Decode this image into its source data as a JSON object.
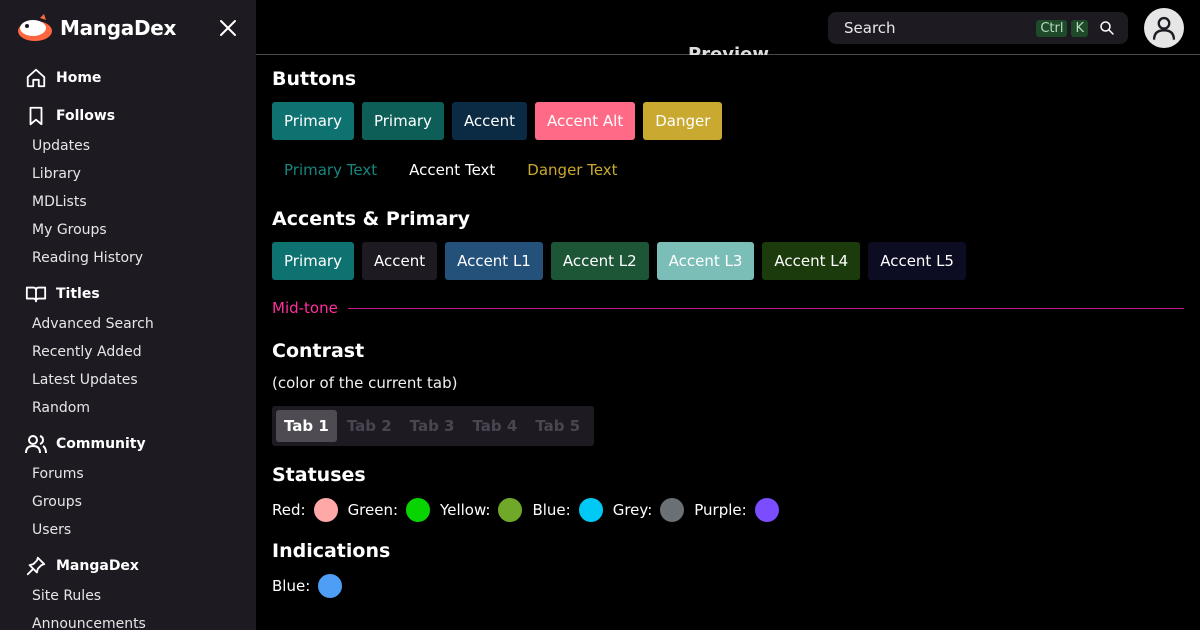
{
  "sidebar": {
    "brand": "MangaDex",
    "sections": [
      {
        "label": "Home",
        "icon": "home-icon",
        "items": []
      },
      {
        "label": "Follows",
        "icon": "bookmark-icon",
        "items": [
          "Updates",
          "Library",
          "MDLists",
          "My Groups",
          "Reading History"
        ]
      },
      {
        "label": "Titles",
        "icon": "book-open-icon",
        "items": [
          "Advanced Search",
          "Recently Added",
          "Latest Updates",
          "Random"
        ]
      },
      {
        "label": "Community",
        "icon": "users-icon",
        "items": [
          "Forums",
          "Groups",
          "Users"
        ]
      },
      {
        "label": "MangaDex",
        "icon": "pin-icon",
        "items": [
          "Site Rules",
          "Announcements"
        ]
      }
    ]
  },
  "header": {
    "search_placeholder": "Search",
    "shortcut_ctrl": "Ctrl",
    "shortcut_key": "K",
    "preview_label": "Preview"
  },
  "main": {
    "buttons_heading": "Buttons",
    "buttons": [
      {
        "label": "Primary",
        "bg": "#0d7270",
        "fg": "#ffffff"
      },
      {
        "label": "Primary",
        "bg": "#0e5e58",
        "fg": "#ffffff"
      },
      {
        "label": "Accent",
        "bg": "#0b2b44",
        "fg": "#ffffff"
      },
      {
        "label": "Accent Alt",
        "bg": "#ff6a87",
        "fg": "#ffffff"
      },
      {
        "label": "Danger",
        "bg": "#c9a92f",
        "fg": "#ffffff"
      }
    ],
    "text_buttons": [
      {
        "label": "Primary Text",
        "color": "#17867e"
      },
      {
        "label": "Accent Text",
        "color": "#ffffff"
      },
      {
        "label": "Danger Text",
        "color": "#c9a92f"
      }
    ],
    "accents_heading": "Accents & Primary",
    "accents": [
      {
        "label": "Primary",
        "bg": "#0d7270",
        "fg": "#ffffff"
      },
      {
        "label": "Accent",
        "bg": "#1e1a22",
        "fg": "#ffffff"
      },
      {
        "label": "Accent L1",
        "bg": "#24517a",
        "fg": "#ffffff"
      },
      {
        "label": "Accent L2",
        "bg": "#1d5537",
        "fg": "#ffffff"
      },
      {
        "label": "Accent L3",
        "bg": "#7bbeb7",
        "fg": "#ffffff"
      },
      {
        "label": "Accent L4",
        "bg": "#1b3b0c",
        "fg": "#ffffff"
      },
      {
        "label": "Accent L5",
        "bg": "#0c0c22",
        "fg": "#ffffff"
      }
    ],
    "midtone_label": "Mid-tone",
    "contrast_heading": "Contrast",
    "contrast_sub": "(color of the current tab)",
    "tabs": [
      {
        "label": "Tab 1",
        "active": true
      },
      {
        "label": "Tab 2",
        "active": false
      },
      {
        "label": "Tab 3",
        "active": false
      },
      {
        "label": "Tab 4",
        "active": false
      },
      {
        "label": "Tab 5",
        "active": false
      }
    ],
    "statuses_heading": "Statuses",
    "statuses": [
      {
        "label": "Red:",
        "color": "#ffa8a8"
      },
      {
        "label": "Green:",
        "color": "#07d400"
      },
      {
        "label": "Yellow:",
        "color": "#70a829"
      },
      {
        "label": "Blue:",
        "color": "#00c9f5"
      },
      {
        "label": "Grey:",
        "color": "#6b7075"
      },
      {
        "label": "Purple:",
        "color": "#7b4dff"
      }
    ],
    "indications_heading": "Indications",
    "indications": [
      {
        "label": "Blue:",
        "color": "#4f9ef5"
      }
    ]
  }
}
